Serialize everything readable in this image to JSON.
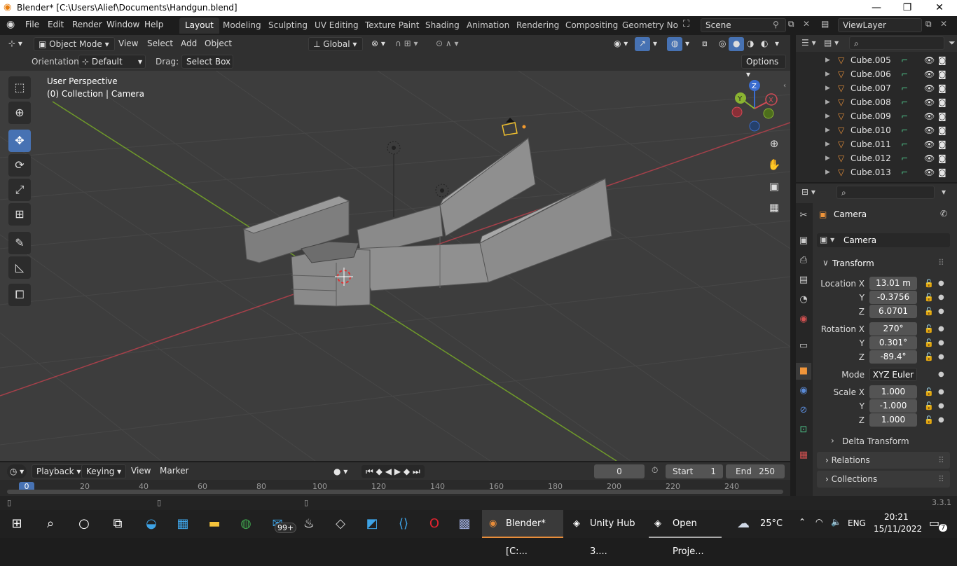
{
  "window": {
    "title": "Blender* [C:\\Users\\Alief\\Documents\\Handgun.blend]"
  },
  "menu": {
    "items": [
      "File",
      "Edit",
      "Render",
      "Window",
      "Help"
    ]
  },
  "workspaces": [
    "Layout",
    "Modeling",
    "Sculpting",
    "UV Editing",
    "Texture Paint",
    "Shading",
    "Animation",
    "Rendering",
    "Compositing",
    "Geometry Noc"
  ],
  "scene": {
    "name": "Scene",
    "view_layer": "ViewLayer"
  },
  "viewport_header": {
    "mode": "Object Mode",
    "menus": [
      "View",
      "Select",
      "Add",
      "Object"
    ],
    "transform_orientation": "Global",
    "options_label": "Options",
    "orientation_label": "Orientation:",
    "orientation_value": "Default",
    "drag_label": "Drag:",
    "drag_value": "Select Box"
  },
  "viewport": {
    "perspective": "User Perspective",
    "collection_info": "(0) Collection | Camera",
    "gizmo": {
      "x": "X",
      "y": "Y",
      "z": "Z"
    }
  },
  "outliner": {
    "items": [
      "Cube.005",
      "Cube.006",
      "Cube.007",
      "Cube.008",
      "Cube.009",
      "Cube.010",
      "Cube.011",
      "Cube.012",
      "Cube.013"
    ]
  },
  "properties": {
    "object_name": "Camera",
    "data_name": "Camera",
    "transform_label": "Transform",
    "location_label": "Location X",
    "rotation_label": "Rotation X",
    "scale_label": "Scale X",
    "y_label": "Y",
    "z_label": "Z",
    "location": [
      "13.01 m",
      "-0.3756",
      "6.0701"
    ],
    "rotation": [
      "270°",
      "0.301°",
      "-89.4°"
    ],
    "mode_label": "Mode",
    "mode_value": "XYZ Euler",
    "scale": [
      "1.000",
      "-1.000",
      "1.000"
    ],
    "delta_transform": "Delta Transform",
    "relations": "Relations",
    "collections": "Collections"
  },
  "timeline": {
    "menus": [
      "Playback",
      "Keying",
      "View",
      "Marker"
    ],
    "current_frame": "0",
    "start_label": "Start",
    "start_value": "1",
    "end_label": "End",
    "end_value": "250",
    "ruler": [
      "0",
      "20",
      "40",
      "60",
      "80",
      "100",
      "120",
      "140",
      "160",
      "180",
      "200",
      "220",
      "240"
    ]
  },
  "status": {
    "version": "3.3.1"
  },
  "taskbar": {
    "apps": [
      "Blender* [C:...",
      "Unity Hub 3....",
      "Open Proje..."
    ],
    "mail_badge": "99+",
    "weather": "25°C",
    "language": "ENG",
    "time": "20:21",
    "date": "15/11/2022",
    "notifications": "7"
  }
}
